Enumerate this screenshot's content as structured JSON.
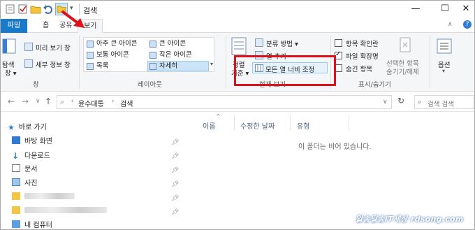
{
  "window": {
    "title": "검색",
    "minimize_glyph": "—",
    "maximize_glyph": "☐",
    "close_glyph": "✕"
  },
  "ribbon_tabs": [
    {
      "label": "파일"
    },
    {
      "label": "홈"
    },
    {
      "label": "공유"
    },
    {
      "label": "보기"
    }
  ],
  "pane_group": {
    "nav_pane_label_1": "탐색",
    "nav_pane_label_2": "창 ▾",
    "preview_label": "미리 보기 창",
    "details_label": "세부 정보 창",
    "group_label": "창"
  },
  "layout_group": {
    "items": [
      {
        "label": "아주 큰 아이콘"
      },
      {
        "label": "큰 아이콘"
      },
      {
        "label": "보통 아이콘"
      },
      {
        "label": "작은 아이콘"
      },
      {
        "label": "목록"
      },
      {
        "label": "자세히"
      }
    ],
    "group_label": "레이아웃"
  },
  "current_view_group": {
    "sort_label_1": "정렬",
    "sort_label_2": "기준 ▾",
    "group_by_label": "분류 방법 ▾",
    "add_columns_label": "열 추가",
    "size_all_columns_label": "모든 열 너비 조정",
    "group_label": "현재 보기"
  },
  "show_hide_group": {
    "item_checkboxes_label": "항목 확인란",
    "file_extensions_label": "파일 확장명",
    "hidden_items_label": "숨긴 항목",
    "file_extensions_checked": true,
    "hide_selected_label_1": "선택한 항목",
    "hide_selected_label_2": "숨기기/해제",
    "group_label": "표시/숨기기"
  },
  "options_label": "옵션",
  "address": {
    "path": [
      "윤수대통",
      "검색"
    ],
    "search_placeholder": "검색 검색"
  },
  "nav_pane": {
    "quick_access": "바로 가기",
    "items": [
      {
        "label": "바탕 화면"
      },
      {
        "label": "다운로드"
      },
      {
        "label": "문서"
      },
      {
        "label": "사진"
      }
    ],
    "bottom_item": "내 컴퓨터"
  },
  "columns": [
    {
      "label": "이름"
    },
    {
      "label": "수정한 날짜"
    },
    {
      "label": "유형"
    }
  ],
  "empty_message": "이 폴더는 비어 있습니다.",
  "watermark": "알송달송IT세상 rdsong.com",
  "colors": {
    "file_tab": "#1979ca",
    "highlight_red": "#e0101b",
    "ribbon_bg": "#f5f6f7",
    "column_header_text": "#4c607a"
  }
}
